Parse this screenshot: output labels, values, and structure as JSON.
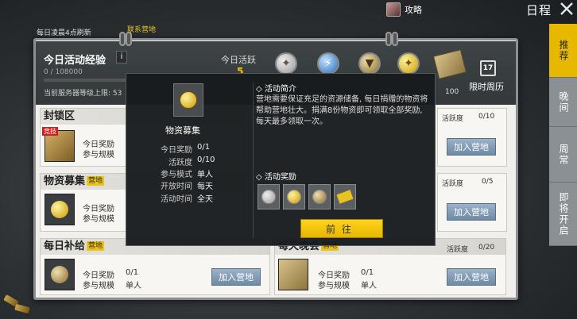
{
  "topbar": {
    "attack_guide_label": "攻略",
    "schedule_title": "日程"
  },
  "banner": {
    "refresh_text": "每日凌晨4点刷新",
    "contact_text": "联系营地"
  },
  "header": {
    "title": "今日活动经验",
    "info_label": "i",
    "exp_value": "0 / 108000",
    "server_level": "当前服务器等级上限: 53",
    "activity_label": "今日活跃",
    "activity_value": "5",
    "reward_count": "100",
    "calendar_day": "17",
    "weekly_calendar_label": "限时周历"
  },
  "cards": [
    {
      "title": "封锁区",
      "tag": "竞技",
      "reward_label": "今日奖励",
      "mode_label": "参与规模",
      "activity_label": "活跃度",
      "activity_value": "0/10",
      "join_label": "加入营地"
    },
    {
      "title": "物资募集",
      "camp_tag": "营地",
      "reward_label": "今日奖励",
      "mode_label": "参与规模",
      "activity_label": "活跃度",
      "activity_value": "0/5",
      "join_label": "加入营地"
    },
    {
      "title": "每日补给",
      "camp_tag": "营地",
      "reward_label": "今日奖励",
      "reward_value": "0/1",
      "mode_label": "参与规模",
      "mode_value": "单人",
      "join_label": "加入营地"
    },
    {
      "title": "每天晚会",
      "camp_tag": "营地",
      "reward_label": "今日奖励",
      "reward_value": "0/1",
      "mode_label": "参与规模",
      "mode_value": "单人",
      "activity_label": "活跃度",
      "activity_value": "0/20",
      "join_label": "加入营地"
    }
  ],
  "popup": {
    "name": "物资募集",
    "kv": [
      {
        "key": "今日奖励",
        "val": "0/1"
      },
      {
        "key": "活跃度",
        "val": "0/10"
      },
      {
        "key": "参与模式",
        "val": "单人"
      },
      {
        "key": "开放时间",
        "val": "每天"
      },
      {
        "key": "活动时间",
        "val": "全天"
      }
    ],
    "intro_title": "活动简介",
    "intro_text": "营地需要保证充足的资源储备, 每日捐赠的物资将帮助营地壮大。捐满8份物资即可领取全部奖励, 每天最多领取一次。",
    "reward_title": "活动奖励",
    "go_label": "前往"
  },
  "sidebar": {
    "tabs": [
      "推荐",
      "晚间",
      "周常",
      "即将开启"
    ]
  }
}
